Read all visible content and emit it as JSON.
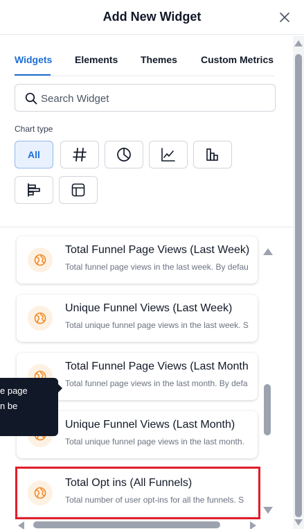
{
  "header": {
    "title": "Add New Widget"
  },
  "tabs": [
    {
      "label": "Widgets",
      "active": true
    },
    {
      "label": "Elements",
      "active": false
    },
    {
      "label": "Themes",
      "active": false
    },
    {
      "label": "Custom Metrics",
      "active": false
    }
  ],
  "search": {
    "placeholder": "Search Widget",
    "value": ""
  },
  "chart_type": {
    "label": "Chart type",
    "options": [
      {
        "label": "All",
        "icon": "all",
        "active": true
      },
      {
        "label": "",
        "icon": "hash-icon",
        "active": false
      },
      {
        "label": "",
        "icon": "pie-chart-icon",
        "active": false
      },
      {
        "label": "",
        "icon": "line-chart-icon",
        "active": false
      },
      {
        "label": "",
        "icon": "bar-chart-icon",
        "active": false
      },
      {
        "label": "",
        "icon": "horizontal-bar-chart-icon",
        "active": false
      },
      {
        "label": "",
        "icon": "table-icon",
        "active": false
      }
    ]
  },
  "widgets": [
    {
      "title": "Total Funnel Page Views (Last Week)",
      "description": "Total funnel page views in the last week. By defau",
      "icon": "globe-icon"
    },
    {
      "title": "Unique Funnel Views (Last Week)",
      "description": "Total unique funnel page views in the last week. S",
      "icon": "globe-icon"
    },
    {
      "title": "Total Funnel Page Views (Last Month",
      "description": "Total funnel page views in the last month. By defa",
      "icon": "globe-icon"
    },
    {
      "title": "Unique Funnel Views (Last Month)",
      "description": "Total unique funnel page views in the last month.",
      "icon": "globe-icon"
    },
    {
      "title": "Total Opt ins (All Funnels)",
      "description": "Total number of user opt-ins for all the funnels. S",
      "icon": "globe-icon",
      "highlighted": true
    }
  ],
  "tooltip": {
    "lines": [
      "e page",
      "n be"
    ]
  },
  "colors": {
    "accent": "#1d6fd6",
    "icon_orange": "#f08a24",
    "icon_bg": "#fdf1e3",
    "highlight": "#e11d2a",
    "tooltip_bg": "#111827"
  }
}
